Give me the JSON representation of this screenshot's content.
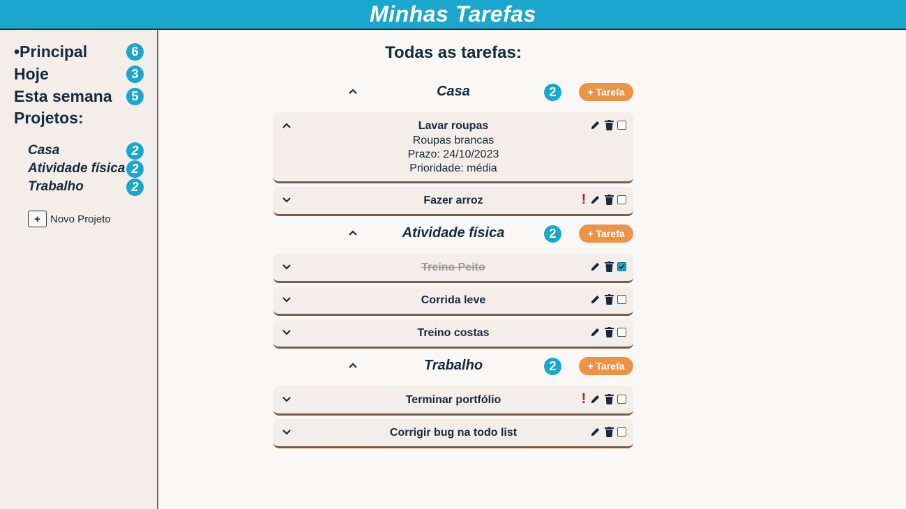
{
  "header": {
    "title": "Minhas Tarefas"
  },
  "sidebar": {
    "nav": [
      {
        "label": "•Principal",
        "count": "6"
      },
      {
        "label": "Hoje",
        "count": "3"
      },
      {
        "label": "Esta semana",
        "count": "5"
      }
    ],
    "projects_title": "Projetos:",
    "projects": [
      {
        "label": "Casa",
        "count": "2"
      },
      {
        "label": "Atividade física",
        "count": "2"
      },
      {
        "label": "Trabalho",
        "count": "2"
      }
    ],
    "new_project": {
      "icon": "+",
      "label": "Novo Projeto"
    }
  },
  "main": {
    "title": "Todas as tarefas:",
    "add_task_label": "+ Tarefa",
    "groups": [
      {
        "name": "Casa",
        "count": "2",
        "tasks": [
          {
            "name": "Lavar roupas",
            "expanded": true,
            "description": "Roupas brancas",
            "due": "Prazo: 24/10/2023",
            "priority": "Prioridade: média",
            "important": false,
            "done": false
          },
          {
            "name": "Fazer arroz",
            "expanded": false,
            "important": true,
            "done": false
          }
        ]
      },
      {
        "name": "Atividade física",
        "count": "2",
        "tasks": [
          {
            "name": "Treino Peito",
            "expanded": false,
            "important": false,
            "done": true
          },
          {
            "name": "Corrida leve",
            "expanded": false,
            "important": false,
            "done": false
          },
          {
            "name": "Treino costas",
            "expanded": false,
            "important": false,
            "done": false
          }
        ]
      },
      {
        "name": "Trabalho",
        "count": "2",
        "tasks": [
          {
            "name": "Terminar portfólio",
            "expanded": false,
            "important": true,
            "done": false
          },
          {
            "name": "Corrigir bug na todo list",
            "expanded": false,
            "important": false,
            "done": false
          }
        ]
      }
    ]
  },
  "colors": {
    "accent": "#1ba7cd",
    "orange": "#ec9346",
    "dark": "#17293a",
    "card": "#f3eeea",
    "card_border": "#7a5c4a",
    "important": "#b1201c"
  },
  "icons": {
    "chevron_up": "chevron-up-icon",
    "chevron_down": "chevron-down-icon",
    "edit": "pencil-icon",
    "delete": "trash-icon",
    "important": "exclamation-icon"
  }
}
